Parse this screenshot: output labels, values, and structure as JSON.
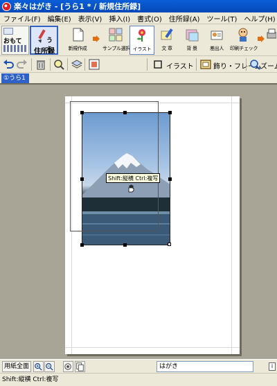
{
  "window": {
    "title": "楽々はがき - [うら1 * / 新規住所録]"
  },
  "menubar": {
    "items": [
      "ファイル(F)",
      "編集(E)",
      "表示(V)",
      "挿入(I)",
      "書式(O)",
      "住所録(A)",
      "ツール(T)",
      "ヘルプ(H)"
    ]
  },
  "side_toggle": {
    "omote_label": "おもて",
    "ura_label": "うら",
    "address_label": "住所録"
  },
  "toolbar1": {
    "new_label": "新規作成",
    "sample_label": "サンプル選択",
    "illust_label": "イラスト",
    "text_label": "文 章",
    "background_label": "背 景",
    "sender_label": "差出人",
    "print_check_label": "印刷チェック"
  },
  "toolbar2": {
    "illust_label": "イラスト",
    "frame_label": "飾り・フレーム",
    "zoom_label": "ズーム・"
  },
  "tabs": [
    {
      "label": "①うら1"
    }
  ],
  "canvas": {
    "tooltip": "Shift:縦横 Ctrl:複写"
  },
  "bottombar": {
    "fit_label": "用紙全面",
    "paper_type": "はがき",
    "info_icon": "i"
  },
  "status": {
    "text": "Shift:縦横 Ctrl:複写"
  },
  "colors": {
    "title_bar": "#0548b8",
    "tab_active": "#2f62c8",
    "workspace": "#a8a596"
  }
}
